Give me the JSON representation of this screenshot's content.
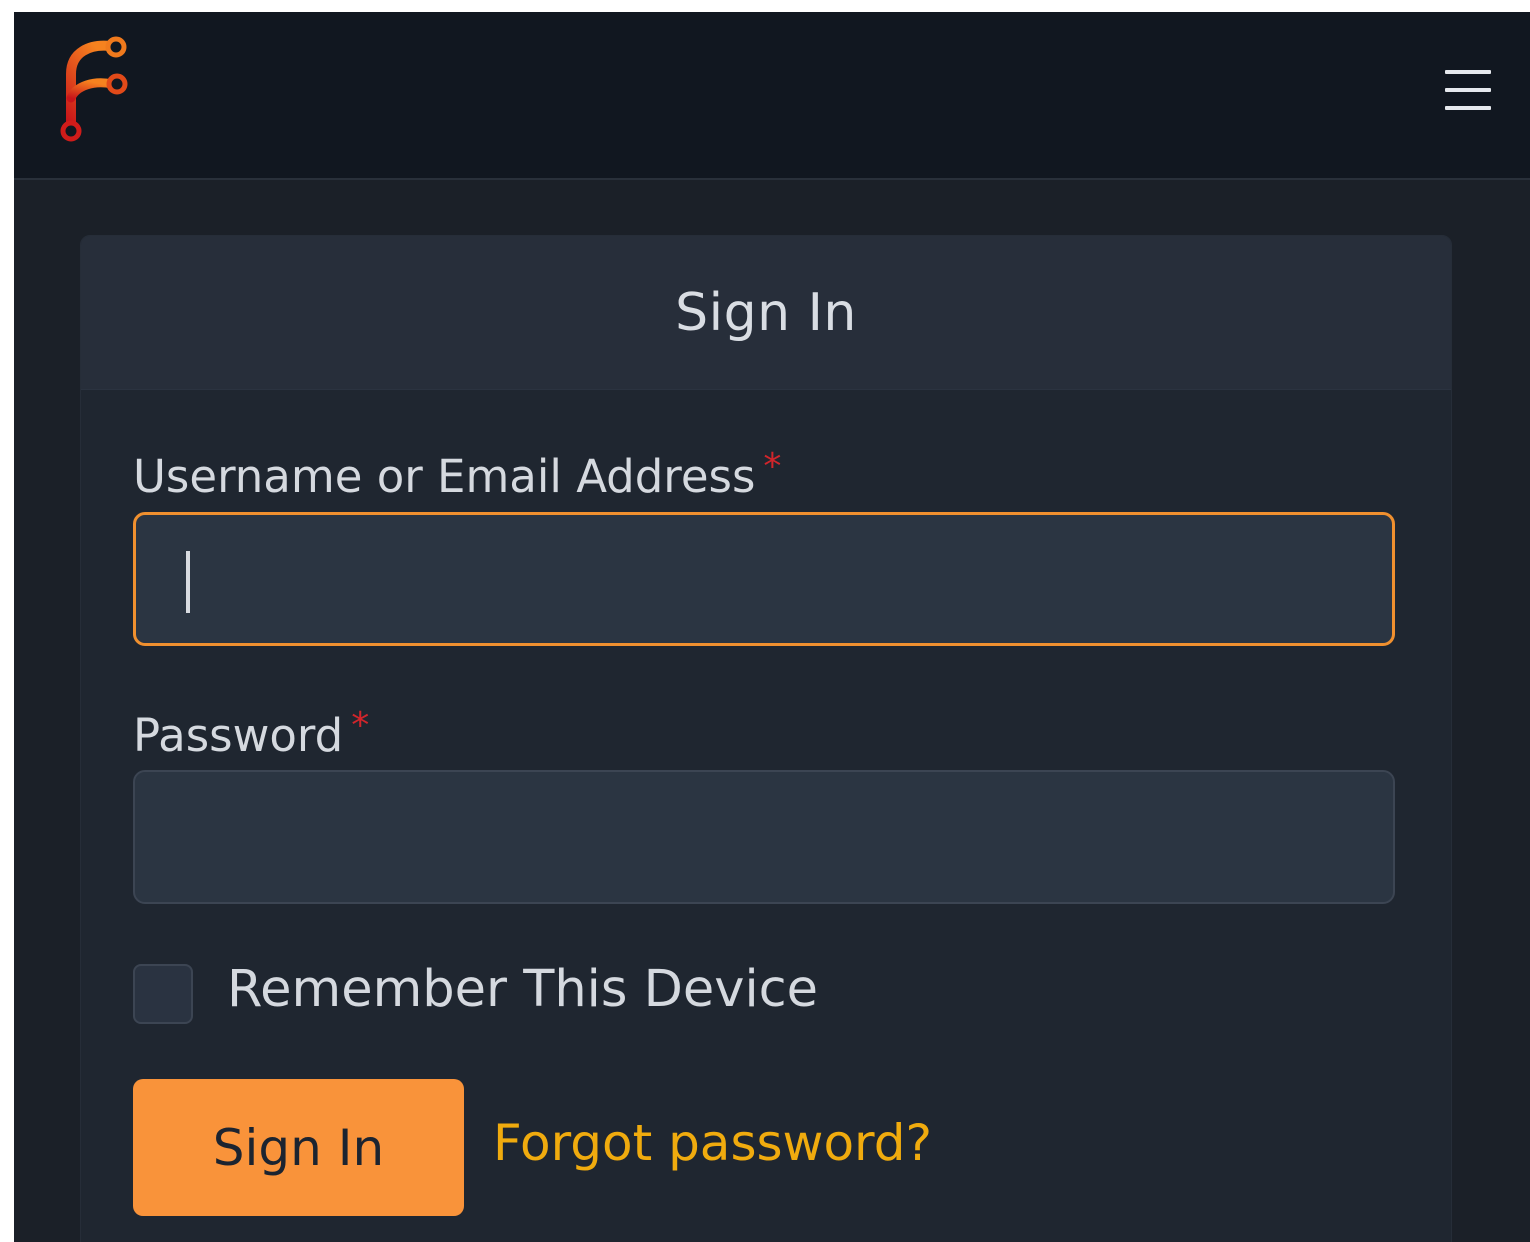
{
  "navbar": {
    "logo_icon": "gitea-style-branch-logo-icon",
    "menu_icon": "hamburger-menu-icon"
  },
  "colors": {
    "accent": "#f9933a",
    "link": "#f0ab0e",
    "required": "#d1252b",
    "focus_border": "#f0902f"
  },
  "signin_card": {
    "title": "Sign In",
    "username": {
      "label": "Username or Email Address",
      "required_mark": "*",
      "value": "",
      "focused": true
    },
    "password": {
      "label": "Password",
      "required_mark": "*",
      "value": ""
    },
    "remember": {
      "label": "Remember This Device",
      "checked": false
    },
    "submit_label": "Sign In",
    "forgot_label": "Forgot password?"
  }
}
